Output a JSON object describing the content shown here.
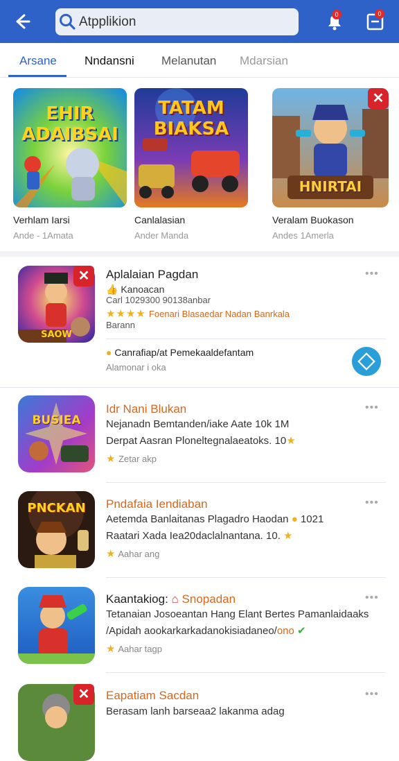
{
  "header": {
    "search_value": "Atpplikion",
    "notif_badge": "0",
    "inbox_badge": "0",
    "back_icon": "back-arrow-icon",
    "search_icon": "search-icon"
  },
  "tabs": [
    {
      "label": "Arsane"
    },
    {
      "label": "Nndansni"
    },
    {
      "label": "Melanutan"
    },
    {
      "label": "Mdarsian"
    }
  ],
  "featured": [
    {
      "name": "Verhlam Iarsi",
      "sub": "Ande - 1Amata",
      "art_title": "EHIR ADAIBSAI"
    },
    {
      "name": "Canlalasian",
      "sub": "Ander Manda",
      "art_title": "TATAM BIAKSA"
    },
    {
      "name": "Veralam Buokason",
      "sub": "Andes 1Amerla",
      "art_title": "HNIRTAI"
    }
  ],
  "list": [
    {
      "title": "Aplalaian Pagdan",
      "line1": "Kanoacan",
      "line2": "Carl 1029300 90138anbar",
      "stars": "★★★★",
      "line3_rest": "Foenari Blasaedar Nadan Banrkala",
      "line4": "Barann",
      "extra_title": "Canrafiap/at Pemekaaldefantam",
      "extra_sub": "Alamonar i oka",
      "art_title": "SAOW"
    },
    {
      "title": "Idr Nani Blukan",
      "line1": "Nejanadn Bemtanden/iake Aate 10k 1M",
      "line2": "Derpat Aasran Ploneltegnalaeatoks. 10",
      "line3": "Zetar akp",
      "art_title": "BUSIEA"
    },
    {
      "title": "Pndafaia Iendiaban",
      "line1": "Aetemda Banlaitanas Plagadro Haodan",
      "line1_tail": "1021",
      "line2": "Raatari Xada Iea20daclalnantana. 10.",
      "line3": "Aahar ang",
      "art_title": "PNCKAN"
    },
    {
      "title": "Kaantakiog:",
      "title_tail": "Snopadan",
      "line1": "Tetanaian Josoeantan Hang Elant Bertes Pamanlaidaaks",
      "line2": "/Apidah aookarkarkadanokisiadaneo/",
      "line2_tail": "ono",
      "line3": "Aahar tagp"
    },
    {
      "title": "Eapatiam Sacdan",
      "line1": "Berasam lanh barseaa2 lakanma adag"
    }
  ],
  "colors": {
    "brand": "#2f62c8",
    "accent_orange": "#d9661a",
    "star": "#f2b01e",
    "close_red": "#d8232a",
    "round_button": "#2a9ed8"
  }
}
